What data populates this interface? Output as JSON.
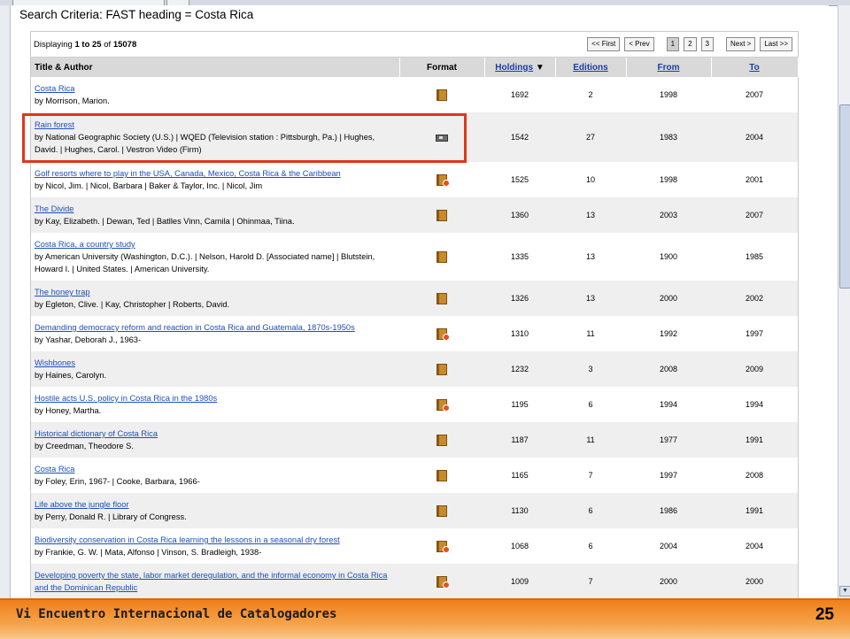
{
  "search": {
    "criteria": "Search Criteria: FAST heading = Costa Rica"
  },
  "display": {
    "prefix": "Displaying",
    "from": "1",
    "to_word": "to",
    "to": "25",
    "of_word": "of",
    "total": "15078"
  },
  "pager": {
    "first": "<< First",
    "prev": "< Prev",
    "pages": [
      "1",
      "2",
      "3"
    ],
    "current_page": "1",
    "next": "Next >",
    "last": "Last >>"
  },
  "columns": {
    "title_author": "Title & Author",
    "format": "Format",
    "holdings": "Holdings",
    "holdings_sort_icon": "sort-descending-icon",
    "editions": "Editions",
    "from": "From",
    "to": "To"
  },
  "rows": [
    {
      "title": "Costa Rica",
      "author": "by Morrison, Marion.",
      "format": "book",
      "holdings": "1692",
      "editions": "2",
      "from": "1998",
      "to": "2007"
    },
    {
      "title": "Rain forest",
      "author": "by National Geographic Society (U.S.) | WQED (Television station : Pittsburgh, Pa.) | Hughes, David. | Hughes, Carol. | Vestron Video (Firm)",
      "format": "video",
      "holdings": "1542",
      "editions": "27",
      "from": "1983",
      "to": "2004"
    },
    {
      "title": "Golf resorts where to play in the USA, Canada, Mexico, Costa Rica & the Caribbean",
      "author": "by Nicol, Jim. | Nicol, Barbara | Baker & Taylor, Inc. | Nicol, Jim",
      "format": "ebook",
      "holdings": "1525",
      "editions": "10",
      "from": "1998",
      "to": "2001"
    },
    {
      "title": "The Divide",
      "author": "by Kay, Elizabeth. | Dewan, Ted | Batlles Vinn, Camila | Ohinmaa, Tiina.",
      "format": "book",
      "holdings": "1360",
      "editions": "13",
      "from": "2003",
      "to": "2007"
    },
    {
      "title": "Costa Rica, a country study",
      "author": "by American University (Washington, D.C.). | Nelson, Harold D. [Associated name] | Blutstein, Howard I. | United States. | American University.",
      "format": "book",
      "holdings": "1335",
      "editions": "13",
      "from": "1900",
      "to": "1985"
    },
    {
      "title": "The honey trap",
      "author": "by Egleton, Clive. | Kay, Christopher | Roberts, David.",
      "format": "book",
      "holdings": "1326",
      "editions": "13",
      "from": "2000",
      "to": "2002"
    },
    {
      "title": "Demanding democracy reform and reaction in Costa Rica and Guatemala, 1870s-1950s",
      "author": "by Yashar, Deborah J., 1963-",
      "format": "ebook",
      "holdings": "1310",
      "editions": "11",
      "from": "1992",
      "to": "1997"
    },
    {
      "title": "Wishbones",
      "author": "by Haines, Carolyn.",
      "format": "book",
      "holdings": "1232",
      "editions": "3",
      "from": "2008",
      "to": "2009"
    },
    {
      "title": "Hostile acts U.S. policy in Costa Rica in the 1980s",
      "author": "by Honey, Martha.",
      "format": "ebook",
      "holdings": "1195",
      "editions": "6",
      "from": "1994",
      "to": "1994"
    },
    {
      "title": "Historical dictionary of Costa Rica",
      "author": "by Creedman, Theodore S.",
      "format": "book",
      "holdings": "1187",
      "editions": "11",
      "from": "1977",
      "to": "1991"
    },
    {
      "title": "Costa Rica",
      "author": "by Foley, Erin, 1967- | Cooke, Barbara, 1966-",
      "format": "book",
      "holdings": "1165",
      "editions": "7",
      "from": "1997",
      "to": "2008"
    },
    {
      "title": "Life above the jungle floor",
      "author": "by Perry, Donald R. | Library of Congress.",
      "format": "book",
      "holdings": "1130",
      "editions": "6",
      "from": "1986",
      "to": "1991"
    },
    {
      "title": "Biodiversity conservation in Costa Rica learning the lessons in a seasonal dry forest",
      "author": "by Frankie, G. W. | Mata, Alfonso | Vinson, S. Bradleigh, 1938-",
      "format": "ebook",
      "holdings": "1068",
      "editions": "6",
      "from": "2004",
      "to": "2004"
    },
    {
      "title": "Developing poverty the state, labor market deregulation, and the informal economy in Costa Rica and the Dominican Republic",
      "author": "",
      "format": "ebook",
      "holdings": "1009",
      "editions": "7",
      "from": "2000",
      "to": "2000"
    }
  ],
  "footer": {
    "title": "Vi Encuentro Internacional de Catalogadores",
    "page_number": "25"
  },
  "colors": {
    "highlight": "#e0361a",
    "link": "#1d4fb8",
    "footer": "#f07f1a"
  }
}
